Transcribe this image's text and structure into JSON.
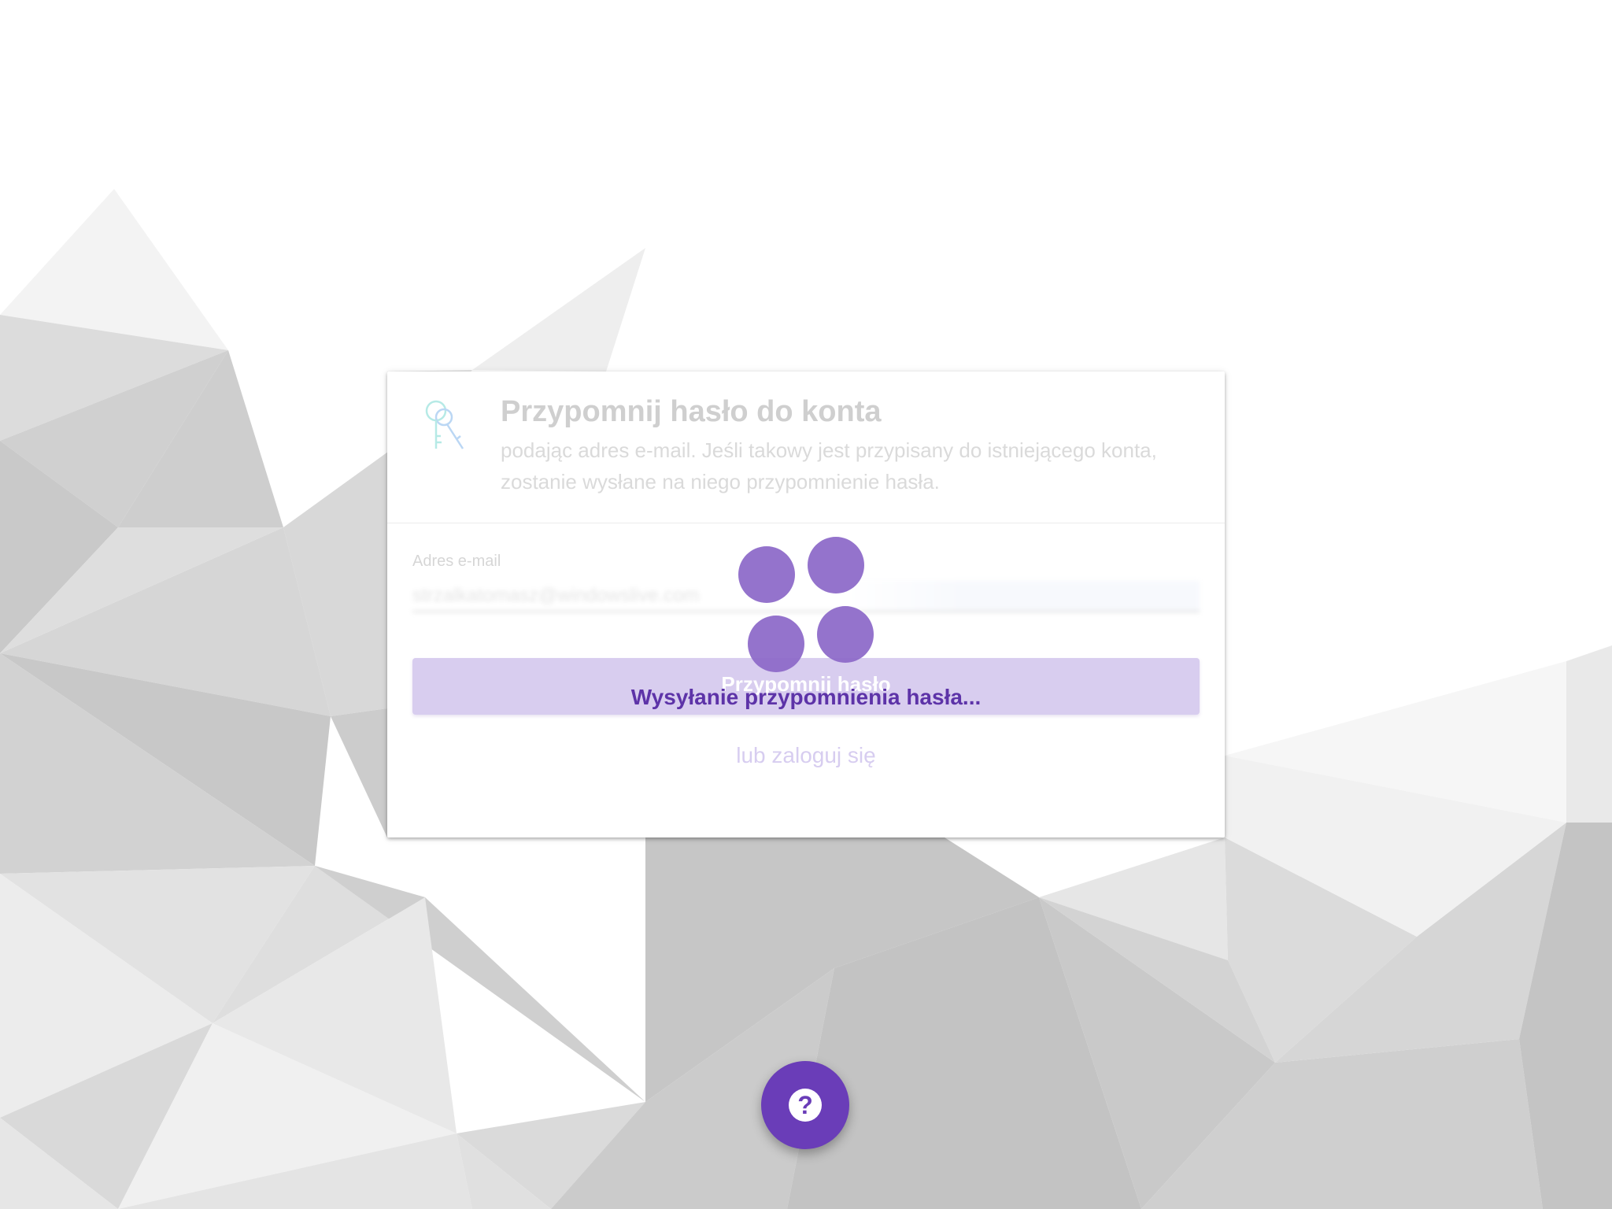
{
  "card": {
    "title": "Przypomnij hasło do konta",
    "subtitle": "podając adres e-mail. Jeśli takowy jest przypisany do istniejącego konta, zostanie wysłane na niego przypomnienie hasła.",
    "icon": "keys-icon"
  },
  "form": {
    "email_label": "Adres e-mail",
    "email_value": "strzalkatomasz@windowslive.com",
    "submit_label": "Przypomnij hasło",
    "login_link": "lub zaloguj się"
  },
  "overlay": {
    "loading_text": "Wysyłanie przypomnienia hasła..."
  },
  "help": {
    "icon": "question-mark-icon",
    "glyph": "?"
  },
  "colors": {
    "accent": "#6a3db8",
    "spinner": "#8c68c8",
    "button_disabled": "#d8cdef",
    "icon_teal": "#7fd6d0"
  }
}
